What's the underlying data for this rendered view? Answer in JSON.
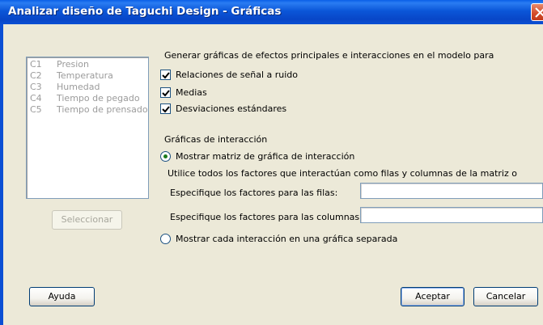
{
  "window": {
    "title": "Analizar diseño de Taguchi Design - Gráficas"
  },
  "columns_list": [
    {
      "id": "C1",
      "name": "Presion"
    },
    {
      "id": "C2",
      "name": "Temperatura"
    },
    {
      "id": "C3",
      "name": "Humedad"
    },
    {
      "id": "C4",
      "name": "Tiempo de pegado"
    },
    {
      "id": "C5",
      "name": "Tiempo de prensado"
    }
  ],
  "select_button": "Seleccionar",
  "effects": {
    "heading": "Generar gráficas de efectos principales e interacciones en el modelo para",
    "options": [
      {
        "label": "Relaciones de señal a ruido",
        "checked": true
      },
      {
        "label": "Medias",
        "checked": true
      },
      {
        "label": "Desviaciones estándares",
        "checked": true
      }
    ]
  },
  "interaction": {
    "heading": "Gráficas de interacción",
    "matrix_option": "Mostrar matriz de gráfica de interacción",
    "matrix_selected": true,
    "matrix_note": "Utilice todos los factores que interactúan como filas y columnas de la matriz o",
    "rows_label": "Especifique los factores para las filas:",
    "rows_value": "",
    "cols_label": "Especifique los factores para las columnas:",
    "cols_value": "",
    "separate_option": "Mostrar cada interacción en una gráfica separada",
    "separate_selected": false
  },
  "buttons": {
    "help": "Ayuda",
    "ok": "Aceptar",
    "cancel": "Cancelar"
  }
}
